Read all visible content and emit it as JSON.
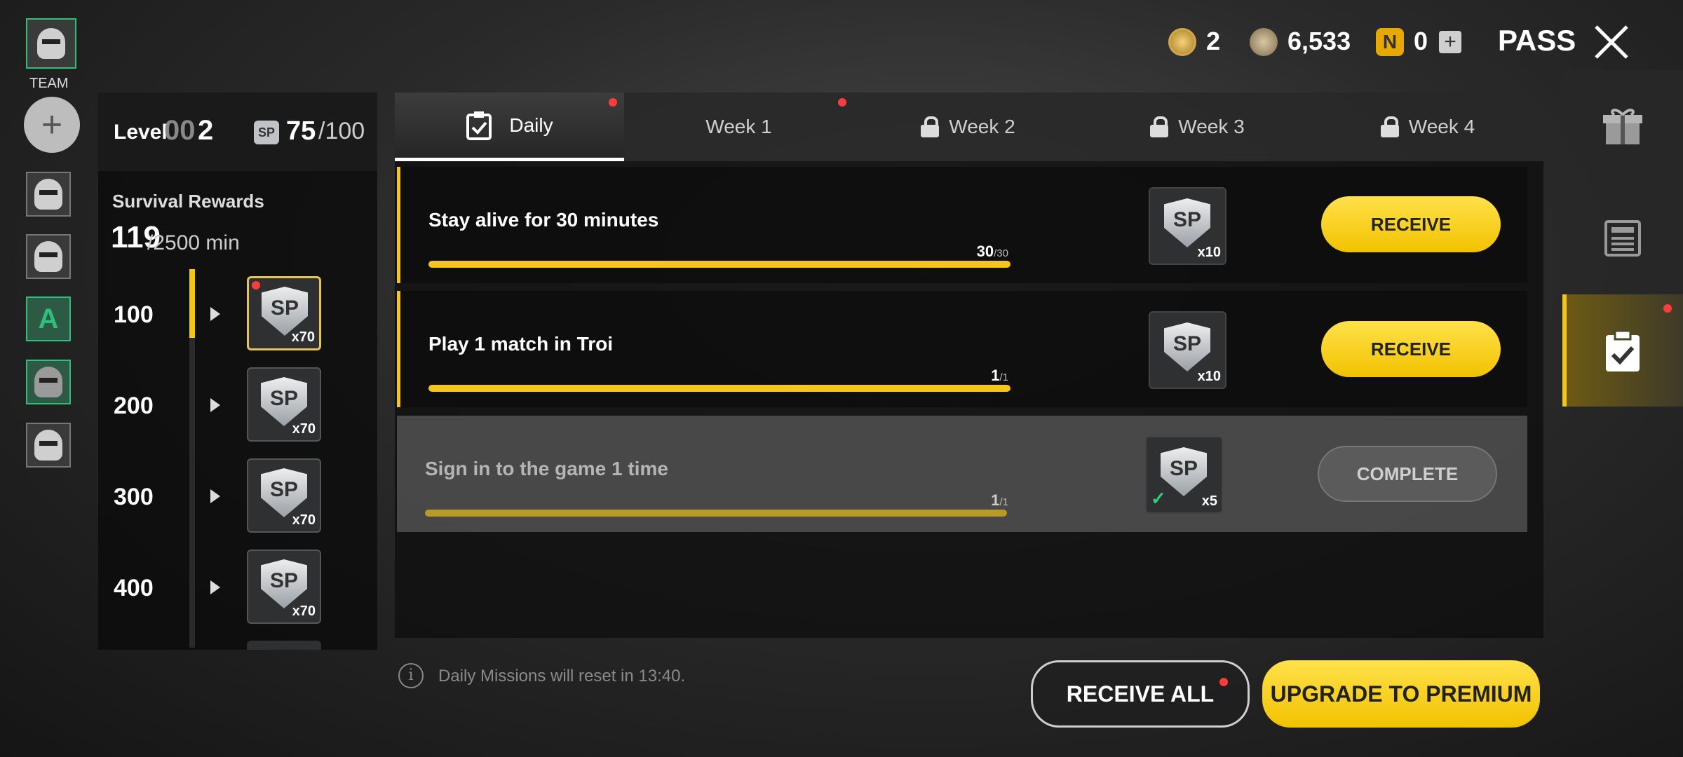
{
  "team": {
    "label": "TEAM"
  },
  "currency": {
    "emblem_count": "2",
    "bp_count": "6,533",
    "n_count": "0",
    "pass_label": "PASS"
  },
  "left": {
    "level_label": "Level",
    "level_dim": "00",
    "level_value": "2",
    "sp_label": "SP",
    "sp_current": "75",
    "sp_total": "/100",
    "survival_title": "Survival Rewards",
    "survival_current": "119",
    "survival_total": "/2500 min",
    "levels": [
      {
        "num": "100",
        "reward": "SP",
        "count": "x70"
      },
      {
        "num": "200",
        "reward": "SP",
        "count": "x70"
      },
      {
        "num": "300",
        "reward": "SP",
        "count": "x70"
      },
      {
        "num": "400",
        "reward": "SP",
        "count": "x70"
      }
    ]
  },
  "tabs": [
    {
      "label": "Daily"
    },
    {
      "label": "Week 1"
    },
    {
      "label": "Week 2"
    },
    {
      "label": "Week 3"
    },
    {
      "label": "Week 4"
    }
  ],
  "missions": [
    {
      "title": "Stay alive for 30 minutes",
      "progress": "30",
      "target": "/30",
      "reward": "SP",
      "reward_count": "x10",
      "button": "RECEIVE"
    },
    {
      "title": "Play 1 match in Troi",
      "progress": "1",
      "target": "/1",
      "reward": "SP",
      "reward_count": "x10",
      "button": "RECEIVE"
    },
    {
      "title": "Sign in to the game 1 time",
      "progress": "1",
      "target": "/1",
      "reward": "SP",
      "reward_count": "x5",
      "button": "COMPLETE"
    }
  ],
  "footer": {
    "reset_text": "Daily Missions will reset in 13:40.",
    "receive_all": "RECEIVE ALL",
    "upgrade": "UPGRADE TO PREMIUM"
  },
  "colors": {
    "accent": "#f5c518",
    "badge": "#ff3b3b"
  }
}
